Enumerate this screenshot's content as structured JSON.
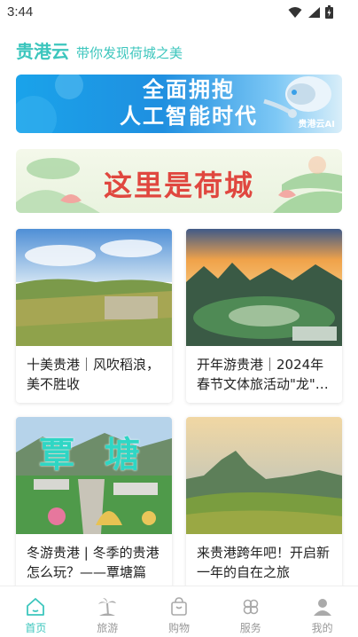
{
  "status_bar": {
    "time": "3:44"
  },
  "header": {
    "title": "贵港云",
    "subtitle": "带你发现荷城之美"
  },
  "banners": {
    "ai": {
      "line1": "全面拥抱",
      "line2": "人工智能时代",
      "badge": "贵港云AI"
    },
    "lotus": {
      "text": "这里是荷城"
    }
  },
  "articles": [
    {
      "title": "十美贵港｜风吹稻浪，美不胜收"
    },
    {
      "title": "开年游贵港｜2024年春节文体旅活动\"龙\"…"
    },
    {
      "title": "冬游贵港 | 冬季的贵港怎么玩？——覃塘篇"
    },
    {
      "title": "来贵港跨年吧！开启新一年的自在之旅"
    }
  ],
  "card3_overlay": "覃 塘",
  "tabs": [
    {
      "label": "首页",
      "icon": "home-icon",
      "active": true
    },
    {
      "label": "旅游",
      "icon": "palm-tree-icon",
      "active": false
    },
    {
      "label": "购物",
      "icon": "shopping-bag-icon",
      "active": false
    },
    {
      "label": "服务",
      "icon": "services-icon",
      "active": false
    },
    {
      "label": "我的",
      "icon": "user-icon",
      "active": false
    }
  ],
  "colors": {
    "accent": "#3cc6bd",
    "tab_inactive": "#999999"
  }
}
